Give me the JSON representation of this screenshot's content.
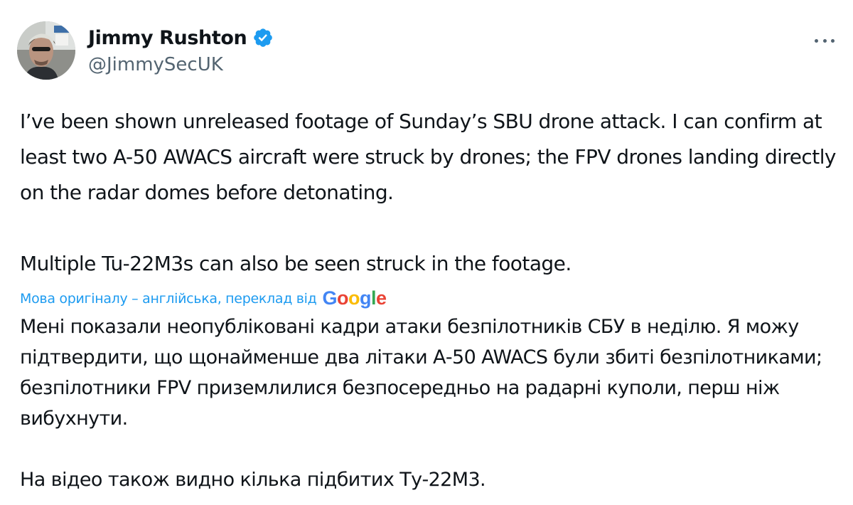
{
  "author": {
    "display_name": "Jimmy Rushton",
    "handle": "@JimmySecUK",
    "verified": true,
    "avatar_icon": "profile-photo",
    "verified_icon": "verified-badge-icon"
  },
  "menu": {
    "icon": "more-options-icon"
  },
  "tweet": {
    "original_paragraphs": [
      "I’ve been shown unreleased footage of Sunday’s SBU drone attack. I can confirm at least two A-50 AWACS aircraft were struck by drones; the FPV drones landing directly on the radar domes before detonating.",
      "Multiple Tu-22M3s can also be seen struck in the footage."
    ],
    "translation_note": "Мова оригіналу – англійська, переклад від",
    "translation_provider": {
      "letters": [
        "G",
        "o",
        "o",
        "g",
        "l",
        "e"
      ],
      "colors": [
        "#4285f4",
        "#ea4335",
        "#fbbc05",
        "#4285f4",
        "#34a853",
        "#ea4335"
      ]
    },
    "translated_paragraphs": [
      "Мені показали неопубліковані кадри атаки безпілотників СБУ в неділю. Я можу підтвердити, що щонайменше два літаки А-50 AWACS були збиті безпілотниками; безпілотники FPV приземлилися безпосередньо на радарні куполи, перш ніж вибухнути.",
      "На відео також видно кілька підбитих Ту-22М3."
    ]
  },
  "colors": {
    "text": "#0f1419",
    "secondary": "#536471",
    "accent": "#1d9bf0"
  }
}
